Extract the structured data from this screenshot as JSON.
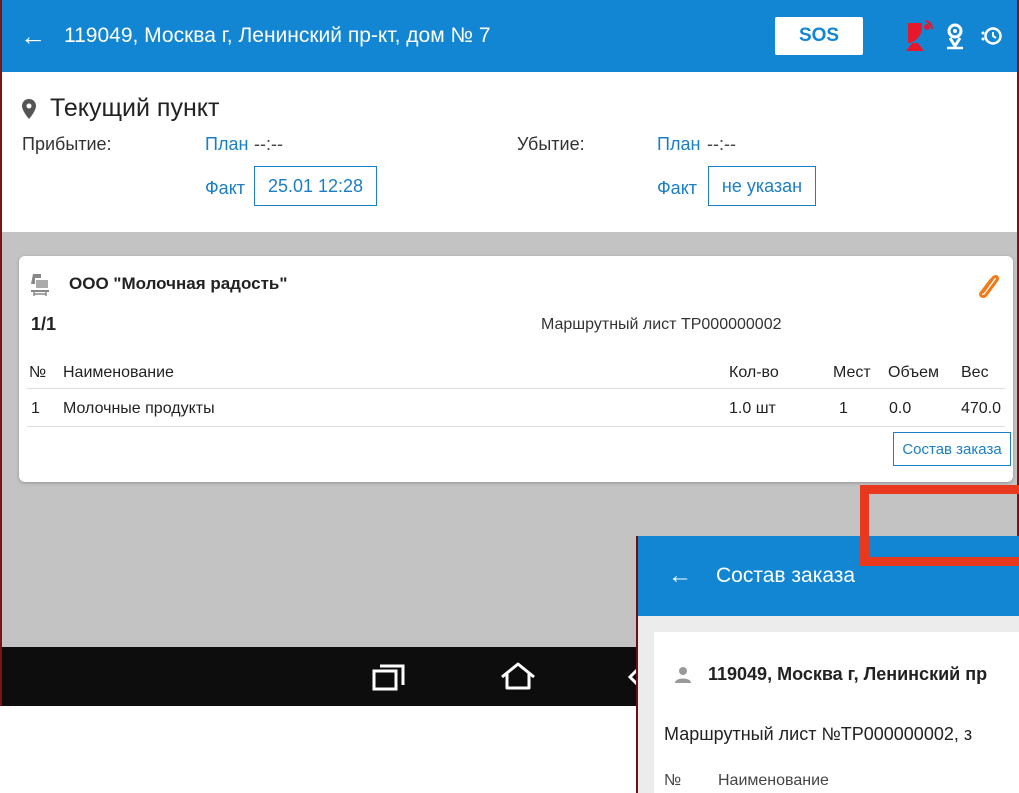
{
  "appbar": {
    "address": "119049, Москва г, Ленинский пр-кт, дом № 7",
    "sos_label": "SOS"
  },
  "current_point": {
    "heading": "Текущий пункт",
    "arrival_label": "Прибытие:",
    "arrival_plan_label": "План",
    "arrival_plan_value": "--:--",
    "arrival_fact_label": "Факт",
    "arrival_fact_value": "25.01 12:28",
    "departure_label": "Убытие:",
    "departure_plan_label": "План",
    "departure_plan_value": "--:--",
    "departure_fact_label": "Факт",
    "departure_fact_value": "не указан"
  },
  "card": {
    "company": "ООО \"Молочная радость\"",
    "counter": "1/1",
    "route_sheet": "Маршрутный лист ТР000000002",
    "columns": [
      "№",
      "Наименование",
      "Кол-во",
      "Мест",
      "Объем",
      "Вес"
    ],
    "rows": [
      [
        "1",
        "Молочные продукты",
        "1.0 шт",
        "1",
        "0.0",
        "470.0"
      ]
    ],
    "order_button": "Состав заказа"
  },
  "overlay": {
    "title": "Состав заказа",
    "address": "119049, Москва г, Ленинский пр",
    "route_sheet": "Маршрутный лист №ТР000000002, з",
    "col_num": "№",
    "col_name": "Наименование"
  },
  "colors": {
    "primary": "#1286d3",
    "link": "#1a7fc6",
    "attach": "#f07a1a",
    "alert": "#e8182c",
    "highlight": "#e8391f"
  }
}
